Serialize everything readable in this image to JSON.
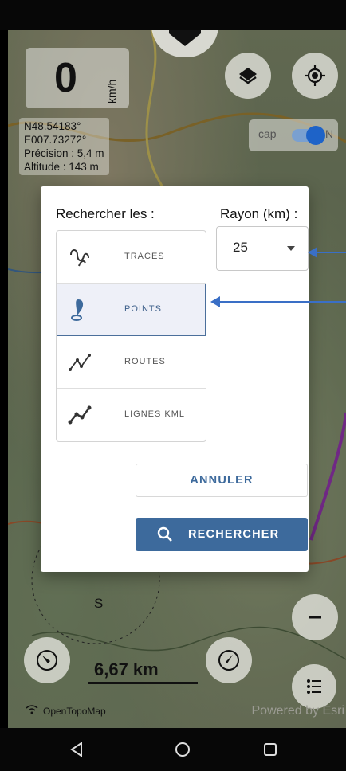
{
  "map": {
    "speed_value": "0",
    "speed_unit": "km/h",
    "coords": {
      "lat": "N48.54183°",
      "lon": "E007.73272°",
      "precision": "Précision : 5,4 m",
      "altitude": "Altitude : 143 m"
    },
    "cap_label": "cap",
    "cap_n": "N",
    "scale": "6,67 km",
    "attribution": "OpenTopoMap",
    "powered": "Powered by Esri",
    "compass_s": "S"
  },
  "dialog": {
    "title": "Rechercher les :",
    "radius_label": "Rayon (km) :",
    "radius_value": "25",
    "items": [
      {
        "label": "TRACES",
        "icon": "track-icon",
        "selected": false
      },
      {
        "label": "POINTS",
        "icon": "pin-icon",
        "selected": true
      },
      {
        "label": "ROUTES",
        "icon": "route-icon",
        "selected": false
      },
      {
        "label": "LIGNES KML",
        "icon": "kml-line-icon",
        "selected": false
      }
    ],
    "cancel_label": "ANNULER",
    "search_label": "RECHERCHER"
  },
  "colors": {
    "accent": "#3d6a9c",
    "arrow": "#3a6fc6",
    "toggle": "#1e63c8"
  }
}
